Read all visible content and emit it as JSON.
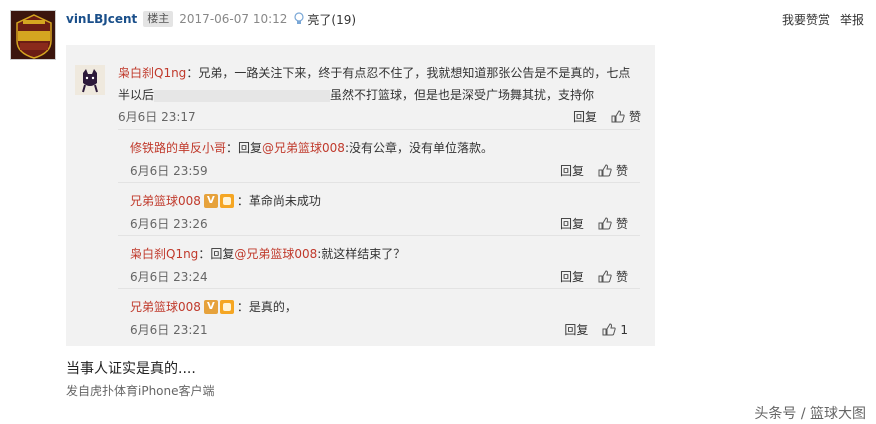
{
  "post": {
    "username": "vinLBJcent",
    "owner_badge": "楼主",
    "time": "2017-06-07 10:12",
    "light_text": "亮了(19)",
    "actions": [
      "我要赞赏",
      "举报"
    ],
    "body": "当事人证实是真的....",
    "source": "发自虎扑体育iPhone客户端"
  },
  "first_comment": {
    "name": "枭白刹Q1ng",
    "text_line1": "：兄弟，一路关注下来，终于有点忍不住了，我就想知道那张公告是不是真的，七点",
    "text_line2_a": "半以后",
    "text_line2_b": "虽然不打篮球，但是也是深受广场舞其扰，支持你",
    "time": "6月6日 23:17",
    "reply_label": "回复",
    "like_label": "赞"
  },
  "sub_comments": [
    {
      "name": "修铁路的单反小哥",
      "name_color": "red",
      "has_badges": false,
      "prefix": "：回复",
      "mention": "@兄弟篮球008",
      "text": ":没有公章，没有单位落款。",
      "time": "6月6日 23:59",
      "reply_label": "回复",
      "like_label": "赞"
    },
    {
      "name": "兄弟篮球008",
      "name_color": "red",
      "has_badges": true,
      "prefix": "",
      "mention": "",
      "text": "：革命尚未成功",
      "time": "6月6日 23:26",
      "reply_label": "回复",
      "like_label": "赞"
    },
    {
      "name": "枭白刹Q1ng",
      "name_color": "red",
      "has_badges": false,
      "prefix": "：回复",
      "mention": "@兄弟篮球008",
      "text": ":就这样结束了？",
      "time": "6月6日 23:24",
      "reply_label": "回复",
      "like_label": "赞"
    },
    {
      "name": "兄弟篮球008",
      "name_color": "red",
      "has_badges": true,
      "prefix": "",
      "mention": "",
      "text": "：是真的，",
      "time": "6月6日 23:21",
      "reply_label": "回复",
      "like_label": "1"
    }
  ],
  "badges": {
    "v_letter": "V"
  },
  "watermark": "头条号 / 篮球大图",
  "colors": {
    "name_red": "#c0392b",
    "link_blue": "#1a4f8a",
    "box_bg": "#f2f2f2"
  }
}
